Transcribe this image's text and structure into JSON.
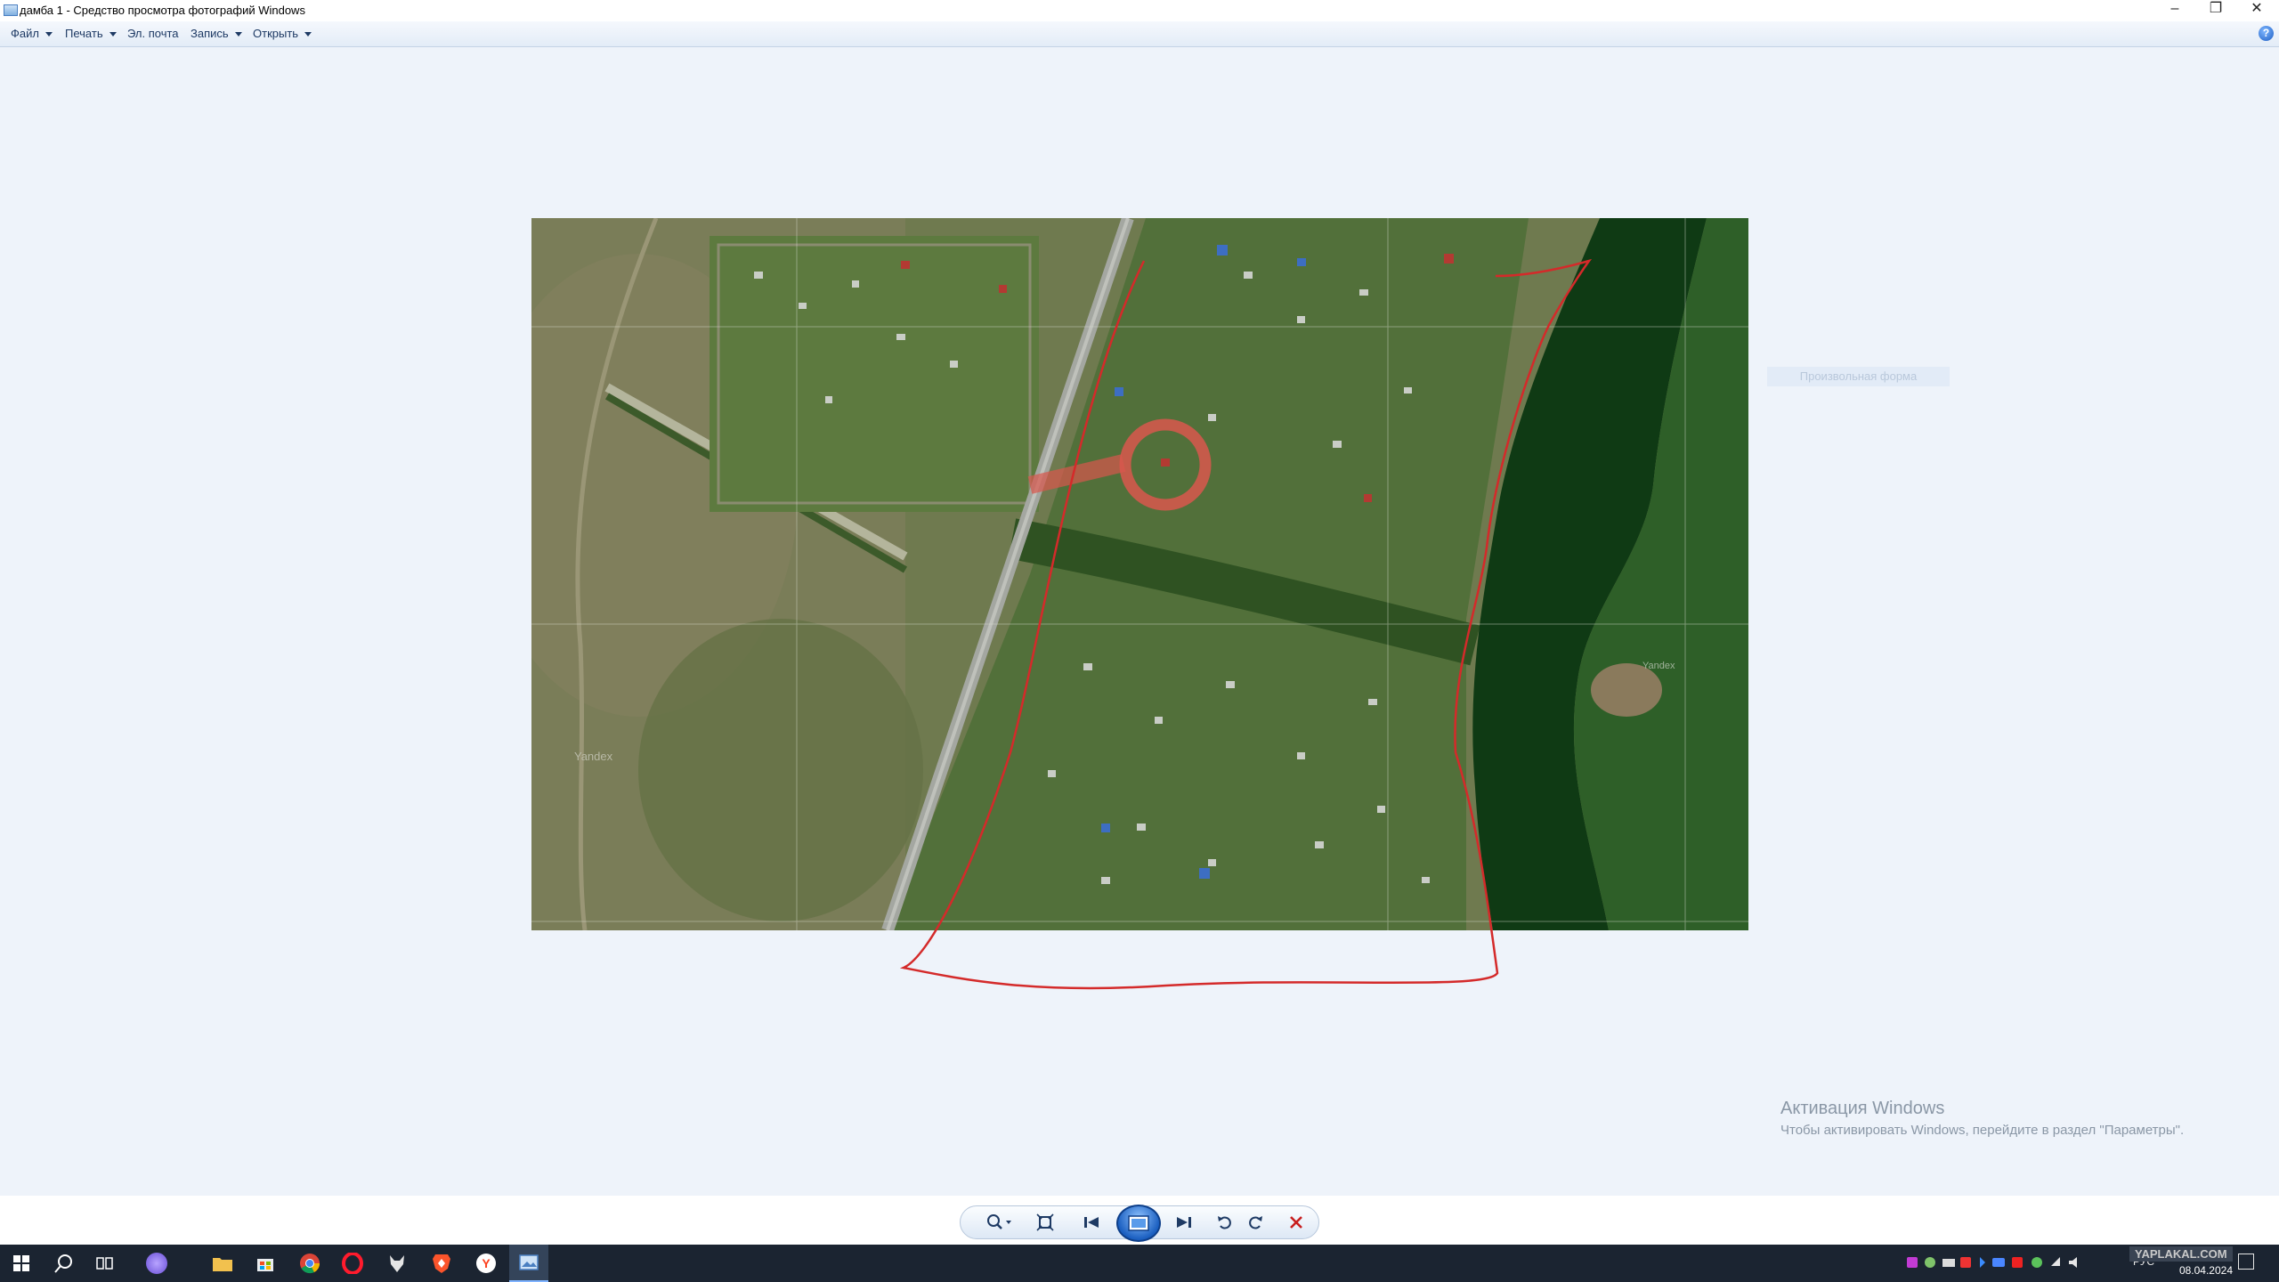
{
  "window": {
    "title": "дамба 1 - Средство просмотра фотографий Windows",
    "minimize": "–",
    "restore": "❐",
    "close": "✕"
  },
  "menu": {
    "items": [
      {
        "label": "Файл",
        "has_dropdown": true
      },
      {
        "label": "Печать",
        "has_dropdown": true
      },
      {
        "label": "Эл. почта",
        "has_dropdown": false
      },
      {
        "label": "Запись",
        "has_dropdown": true
      },
      {
        "label": "Открыть",
        "has_dropdown": true
      }
    ],
    "help": "?"
  },
  "viewer": {
    "image_description": "satellite",
    "faint_label": "Произвольная форма",
    "map_watermark_left": "Yandex",
    "map_watermark_right": "Yandex"
  },
  "activation": {
    "title": "Активация Windows",
    "subtitle": "Чтобы активировать Windows, перейдите в раздел \"Параметры\"."
  },
  "toolbar": {
    "buttons": [
      "zoom-icon",
      "fit-icon",
      "previous-icon",
      "slideshow-icon",
      "next-icon",
      "rotate-left-icon",
      "rotate-right-icon",
      "delete-icon"
    ]
  },
  "taskbar": {
    "apps": [
      "start",
      "search",
      "task-view",
      "alice",
      "explorer",
      "store",
      "chrome",
      "opera",
      "wolf",
      "brave",
      "yandex",
      "photo-viewer"
    ],
    "lang": "РУС",
    "date": "08.04.2024",
    "watermark": "YAPLAKAL.COM"
  },
  "colors": {
    "accent": "#1b5fc0",
    "outline_red": "#d42a2a",
    "water": "#0f3a14"
  }
}
